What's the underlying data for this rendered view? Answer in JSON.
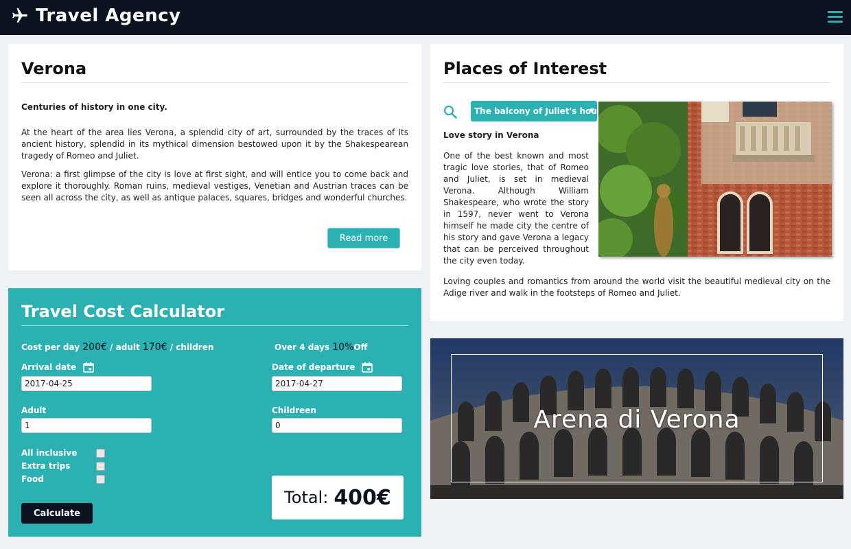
{
  "header": {
    "brand": "Travel Agency",
    "logo_icon": "airplane-icon",
    "menu_icon": "hamburger-icon"
  },
  "verona": {
    "title": "Verona",
    "lead": "Centuries of history in one city.",
    "paragraph1": "At the heart of the area lies Verona, a splendid city of art, surrounded by the traces of its ancient history, splendid in its mythical dimension bestowed upon it by the Shakespearean tragedy of Romeo and Juliet.",
    "paragraph2": "Verona: a first glimpse of the city is love at first sight, and will entice you to come back and explore it thoroughly. Roman ruins, medieval vestiges, Venetian and Austrian traces can be seen all across the city, as well as antique palaces, squares, bridges and wonderful churches.",
    "read_more": "Read more"
  },
  "calculator": {
    "title": "Travel Cost Calculator",
    "cost_prefix": "Cost per day",
    "adult_price": "200€",
    "adult_suffix": "/ adult",
    "child_price": "170€",
    "child_suffix": "/ children",
    "discount_prefix": "Over 4 days",
    "discount_value": "10%",
    "discount_suffix": "Off",
    "arrival_label": "Arrival date",
    "arrival_value": "2017-04-25",
    "departure_label": "Date of departure",
    "departure_value": "2017-04-27",
    "adult_label": "Adult",
    "adult_value": "1",
    "children_label": "Childreen",
    "children_value": "0",
    "options": [
      {
        "label": "All inclusive",
        "checked": false
      },
      {
        "label": "Extra trips",
        "checked": false
      },
      {
        "label": "Food",
        "checked": false
      }
    ],
    "total_label": "Total:",
    "total_value": "400€",
    "calculate": "Calculate"
  },
  "places": {
    "title": "Places of Interest",
    "selected": "The balcony of Juliet's house",
    "subtitle": "Love story in Verona",
    "text": "One of the best known and most tragic love stories, that of Romeo and Juliet, is set in medieval Verona. Although William Shakespeare, who wrote the story in 1597, never went to Verona himself he made city the centre of his story and gave Verona a legacy that can be perceived throughout the city even today.",
    "footer": "Loving couples and romantics from around the world visit the beautiful medieval city on the Adige river and walk in the footsteps of Romeo and Juliet."
  },
  "arena": {
    "title": "Arena di Verona"
  },
  "colors": {
    "accent": "#2cb1b3",
    "dark": "#0b1220",
    "background": "#eef2f5"
  }
}
